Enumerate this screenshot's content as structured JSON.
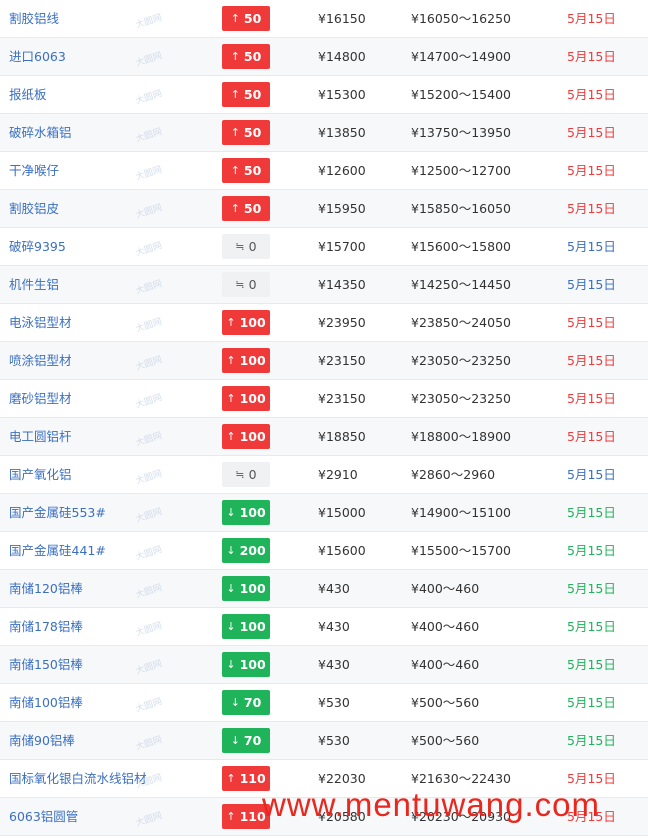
{
  "currency": "¥",
  "range_sep": "～",
  "icons": {
    "up": "arrow-up-icon",
    "down": "arrow-down-icon",
    "flat": "flat-equal-icon"
  },
  "colors": {
    "up": "#f03a3a",
    "down": "#1fb35a",
    "flat": "#3b6fc2",
    "link": "#3b6fc2"
  },
  "watermark_small": "大圆网",
  "watermark_big": "www.mentuwang.com",
  "rows": [
    {
      "name": "割胶铝线",
      "dir": "up",
      "change": "50",
      "price": "16150",
      "low": "16050",
      "high": "16250",
      "date": "5月15日"
    },
    {
      "name": "进口6063",
      "dir": "up",
      "change": "50",
      "price": "14800",
      "low": "14700",
      "high": "14900",
      "date": "5月15日"
    },
    {
      "name": "报纸板",
      "dir": "up",
      "change": "50",
      "price": "15300",
      "low": "15200",
      "high": "15400",
      "date": "5月15日"
    },
    {
      "name": "破碎水箱铝",
      "dir": "up",
      "change": "50",
      "price": "13850",
      "low": "13750",
      "high": "13950",
      "date": "5月15日"
    },
    {
      "name": "干净喉仔",
      "dir": "up",
      "change": "50",
      "price": "12600",
      "low": "12500",
      "high": "12700",
      "date": "5月15日"
    },
    {
      "name": "割胶铝皮",
      "dir": "up",
      "change": "50",
      "price": "15950",
      "low": "15850",
      "high": "16050",
      "date": "5月15日"
    },
    {
      "name": "破碎9395",
      "dir": "flat",
      "change": "0",
      "price": "15700",
      "low": "15600",
      "high": "15800",
      "date": "5月15日"
    },
    {
      "name": "机件生铝",
      "dir": "flat",
      "change": "0",
      "price": "14350",
      "low": "14250",
      "high": "14450",
      "date": "5月15日"
    },
    {
      "name": "电泳铝型材",
      "dir": "up",
      "change": "100",
      "price": "23950",
      "low": "23850",
      "high": "24050",
      "date": "5月15日"
    },
    {
      "name": "喷涂铝型材",
      "dir": "up",
      "change": "100",
      "price": "23150",
      "low": "23050",
      "high": "23250",
      "date": "5月15日"
    },
    {
      "name": "磨砂铝型材",
      "dir": "up",
      "change": "100",
      "price": "23150",
      "low": "23050",
      "high": "23250",
      "date": "5月15日"
    },
    {
      "name": "电工圆铝杆",
      "dir": "up",
      "change": "100",
      "price": "18850",
      "low": "18800",
      "high": "18900",
      "date": "5月15日"
    },
    {
      "name": "国产氧化铝",
      "dir": "flat",
      "change": "0",
      "price": "2910",
      "low": "2860",
      "high": "2960",
      "date": "5月15日"
    },
    {
      "name": "国产金属硅553#",
      "dir": "down",
      "change": "100",
      "price": "15000",
      "low": "14900",
      "high": "15100",
      "date": "5月15日"
    },
    {
      "name": "国产金属硅441#",
      "dir": "down",
      "change": "200",
      "price": "15600",
      "low": "15500",
      "high": "15700",
      "date": "5月15日"
    },
    {
      "name": "南储120铝棒",
      "dir": "down",
      "change": "100",
      "price": "430",
      "low": "400",
      "high": "460",
      "date": "5月15日"
    },
    {
      "name": "南储178铝棒",
      "dir": "down",
      "change": "100",
      "price": "430",
      "low": "400",
      "high": "460",
      "date": "5月15日"
    },
    {
      "name": "南储150铝棒",
      "dir": "down",
      "change": "100",
      "price": "430",
      "low": "400",
      "high": "460",
      "date": "5月15日"
    },
    {
      "name": "南储100铝棒",
      "dir": "down",
      "change": "70",
      "price": "530",
      "low": "500",
      "high": "560",
      "date": "5月15日"
    },
    {
      "name": "南储90铝棒",
      "dir": "down",
      "change": "70",
      "price": "530",
      "low": "500",
      "high": "560",
      "date": "5月15日"
    },
    {
      "name": "国标氧化银白流水线铝材",
      "dir": "up",
      "change": "110",
      "price": "22030",
      "low": "21630",
      "high": "22430",
      "date": "5月15日"
    },
    {
      "name": "6063铝圆管",
      "dir": "up",
      "change": "110",
      "price": "20580",
      "low": "20230",
      "high": "20930",
      "date": "5月15日"
    }
  ]
}
